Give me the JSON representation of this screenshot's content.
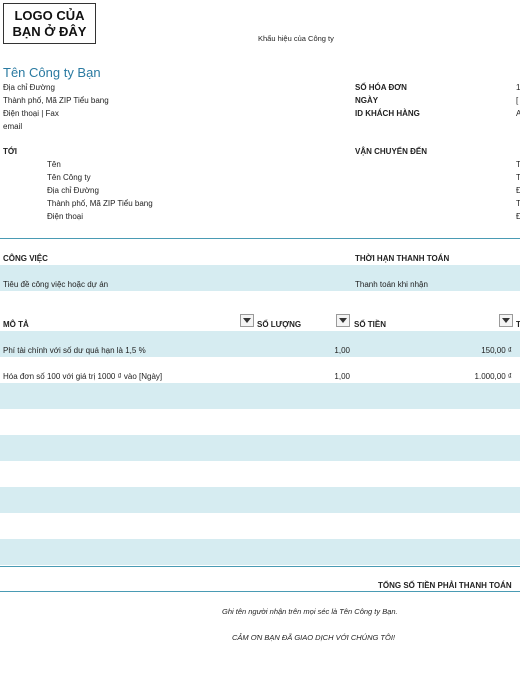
{
  "header": {
    "logo_text": "LOGO CỦA BẠN Ở ĐÂY",
    "slogan": "Khẩu hiệu của Công ty"
  },
  "company": {
    "name": "Tên Công ty Bạn",
    "address": "Địa chỉ Đường",
    "city": "Thành phố, Mã ZIP Tiểu bang",
    "phone": "Điện thoại | Fax",
    "email": "email"
  },
  "invoice_info": {
    "number_label": "SỐ HÓA ĐƠN",
    "number_value": "1",
    "date_label": "NGÀY",
    "date_value": "[",
    "customer_id_label": "ID KHÁCH HÀNG",
    "customer_id_value": "A"
  },
  "to_section": {
    "label": "TỚI",
    "lines": [
      "Tên",
      "Tên Công ty",
      "Địa chỉ Đường",
      "Thành phố, Mã ZIP Tiểu bang",
      "Điện thoại"
    ]
  },
  "ship_section": {
    "label": "VẬN CHUYỂN ĐẾN",
    "lines": [
      "T",
      "T",
      "Đ",
      "T",
      "Đ"
    ]
  },
  "job": {
    "job_label": "CÔNG VIỆC",
    "terms_label": "THỜI HẠN THANH TOÁN",
    "job_value": "Tiêu đề công việc hoặc dự án",
    "terms_value": "Thanh toán khi nhận"
  },
  "table": {
    "columns": [
      "MÔ TẢ",
      "SỐ LƯỢNG",
      "SỐ TIỀN",
      "T"
    ],
    "rows": [
      {
        "description": "Phí tài chính với số dư quá hạn là 1,5 %",
        "quantity": "1,00",
        "amount": "150,00 ₫"
      },
      {
        "description": "Hóa đơn số 100 với giá trị 1000 ₫ vào [Ngày]",
        "quantity": "1,00",
        "amount": "1.000,00 ₫"
      }
    ]
  },
  "footer": {
    "total_label": "TỔNG SỐ TIỀN PHẢI THANH TOÁN",
    "note": "Ghi tên người nhận trên mọi séc là Tên Công ty Bạn.",
    "thanks": "CẢM ƠN BẠN ĐÃ GIAO DỊCH VỚI CHÚNG TÔI!"
  },
  "colors": {
    "accent": "#2a7aa1",
    "band": "#d6ecf1",
    "rule": "#4a9bb4"
  },
  "icons": {
    "filter_dropdown": "chevron-down-icon"
  }
}
